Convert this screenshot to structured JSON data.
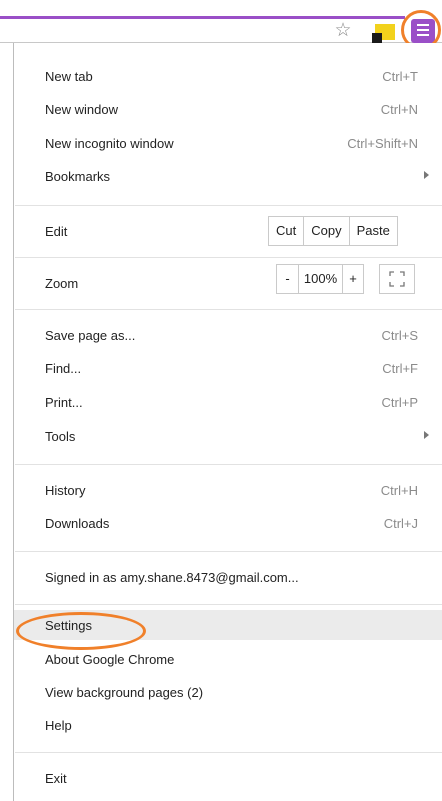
{
  "toolbar": {
    "star_icon": "bookmark-star-icon",
    "extension_icon": "extension-icon",
    "menu_icon": "chrome-menu-icon",
    "accent_color": "#9a4fc7",
    "highlight_ring_color": "#f0802a"
  },
  "menu": {
    "new_tab": {
      "label": "New tab",
      "shortcut": "Ctrl+T"
    },
    "new_window": {
      "label": "New window",
      "shortcut": "Ctrl+N"
    },
    "new_incognito": {
      "label": "New incognito window",
      "shortcut": "Ctrl+Shift+N"
    },
    "bookmarks": {
      "label": "Bookmarks"
    },
    "edit": {
      "label": "Edit",
      "cut": "Cut",
      "copy": "Copy",
      "paste": "Paste"
    },
    "zoom": {
      "label": "Zoom",
      "minus": "-",
      "level": "100%",
      "plus": "+"
    },
    "save_page": {
      "label": "Save page as...",
      "shortcut": "Ctrl+S"
    },
    "find": {
      "label": "Find...",
      "shortcut": "Ctrl+F"
    },
    "print": {
      "label": "Print...",
      "shortcut": "Ctrl+P"
    },
    "tools": {
      "label": "Tools"
    },
    "history": {
      "label": "History",
      "shortcut": "Ctrl+H"
    },
    "downloads": {
      "label": "Downloads",
      "shortcut": "Ctrl+J"
    },
    "signed_in": {
      "label": "Signed in as amy.shane.8473@gmail.com..."
    },
    "settings": {
      "label": "Settings"
    },
    "about": {
      "label": "About Google Chrome"
    },
    "background_pages": {
      "label": "View background pages (2)"
    },
    "help": {
      "label": "Help"
    },
    "exit": {
      "label": "Exit"
    }
  }
}
